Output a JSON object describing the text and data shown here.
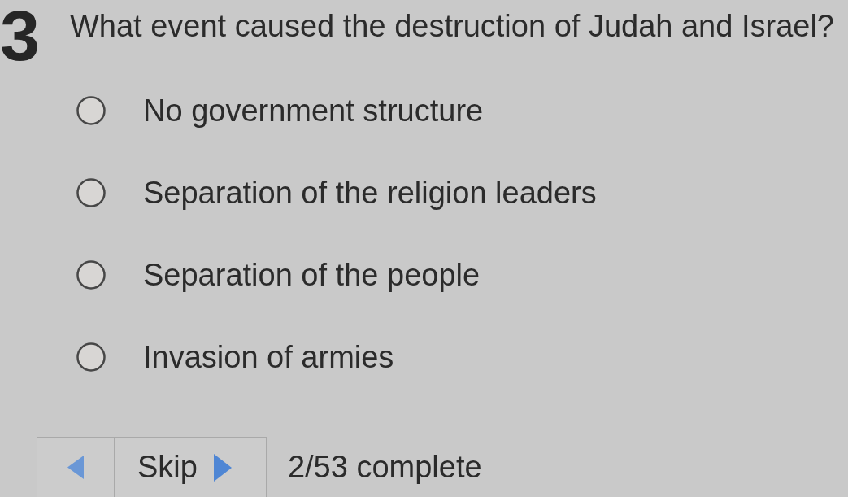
{
  "question": {
    "number": "3",
    "text": "What event caused the destruction of Judah and Israel?"
  },
  "options": [
    {
      "label": "No government structure",
      "selected": false
    },
    {
      "label": "Separation of the religion leaders",
      "selected": false
    },
    {
      "label": "Separation of the people",
      "selected": false
    },
    {
      "label": "Invasion of armies",
      "selected": false
    }
  ],
  "navigation": {
    "skip_label": "Skip"
  },
  "progress": {
    "text": "2/53 complete"
  }
}
